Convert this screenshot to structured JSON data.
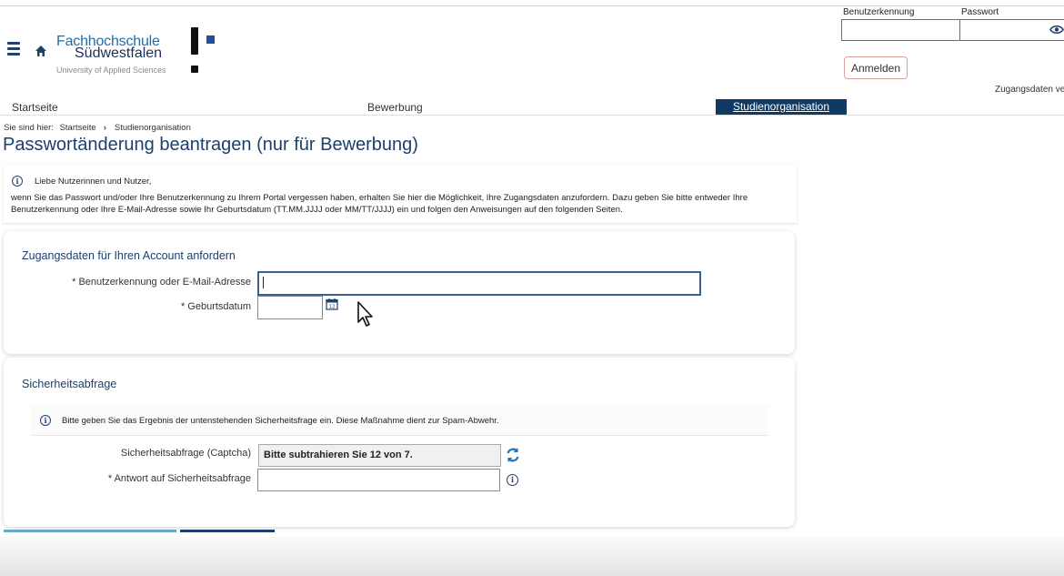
{
  "header": {
    "logo": {
      "line1": "Fachhochschule",
      "line2": "Südwestfalen",
      "line3": "University of Applied Sciences"
    },
    "login": {
      "username_label": "Benutzerkennung",
      "password_label": "Passwort",
      "username_value": "",
      "password_value": "",
      "login_button": "Anmelden",
      "forgot_link": "Zugangsdaten ve"
    }
  },
  "nav": {
    "items": [
      {
        "label": "Startseite"
      },
      {
        "label": "Bewerbung"
      },
      {
        "label": "Studienorganisation",
        "active": true
      }
    ]
  },
  "breadcrumb": {
    "prefix": "Sie sind hier:",
    "items": [
      "Startseite",
      "Studienorganisation"
    ]
  },
  "page_title": "Passwortänderung beantragen (nur für Bewerbung)",
  "info": {
    "greeting": "Liebe Nutzerinnen und Nutzer,",
    "text": "wenn Sie das Passwort und/oder Ihre Benutzerkennung zu Ihrem Portal vergessen haben, erhalten Sie hier die Möglichkeit, Ihre Zugangsdaten anzufordern. Dazu geben Sie bitte entweder Ihre Benutzerkennung oder Ihre E-Mail-Adresse sowie Ihr Geburtsdatum (TT.MM.JJJJ oder MM/TT/JJJJ) ein und folgen den Anweisungen auf den folgenden Seiten."
  },
  "account_section": {
    "title": "Zugangsdaten für Ihren Account anfordern",
    "username_label": "* Benutzerkennung oder E-Mail-Adresse",
    "username_value": "",
    "birthdate_label": "* Geburtsdatum",
    "birthdate_value": "",
    "calendar_icon": "calendar-icon"
  },
  "security_section": {
    "title": "Sicherheitsabfrage",
    "info": "Bitte geben Sie das Ergebnis der untenstehenden Sicherheitsfrage ein. Diese Maßnahme dient zur Spam-Abwehr.",
    "captcha_label": "Sicherheitsabfrage (Captcha)",
    "captcha_value": "Bitte subtrahieren Sie 12 von 7.",
    "answer_label": "* Antwort auf Sicherheitsabfrage",
    "answer_value": ""
  },
  "colors": {
    "primary": "#1c3f6e",
    "nav_active": "#0f3a63",
    "logo_blue": "#1e6fa8",
    "refresh": "#1e73b8"
  }
}
